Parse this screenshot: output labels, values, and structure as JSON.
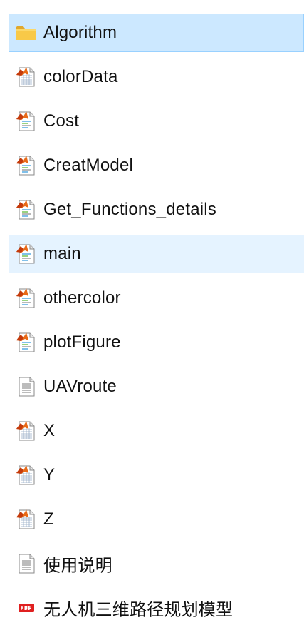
{
  "files": [
    {
      "name": "Algorithm",
      "icon": "folder-icon",
      "state": "selected"
    },
    {
      "name": "colorData",
      "icon": "matlab-data-file-icon",
      "state": ""
    },
    {
      "name": "Cost",
      "icon": "matlab-script-file-icon",
      "state": ""
    },
    {
      "name": "CreatModel",
      "icon": "matlab-script-file-icon",
      "state": ""
    },
    {
      "name": "Get_Functions_details",
      "icon": "matlab-script-file-icon",
      "state": ""
    },
    {
      "name": "main",
      "icon": "matlab-script-file-icon",
      "state": "hovered"
    },
    {
      "name": "othercolor",
      "icon": "matlab-script-file-icon",
      "state": ""
    },
    {
      "name": "plotFigure",
      "icon": "matlab-script-file-icon",
      "state": ""
    },
    {
      "name": "UAVroute",
      "icon": "text-file-icon",
      "state": ""
    },
    {
      "name": "X",
      "icon": "matlab-data-file-icon",
      "state": ""
    },
    {
      "name": "Y",
      "icon": "matlab-data-file-icon",
      "state": ""
    },
    {
      "name": "Z",
      "icon": "matlab-data-file-icon",
      "state": ""
    },
    {
      "name": "使用说明",
      "icon": "text-file-icon",
      "state": ""
    },
    {
      "name": "无人机三维路径规划模型",
      "icon": "pdf-file-icon",
      "state": ""
    }
  ],
  "colors": {
    "selected_bg": "#cce8ff",
    "selected_border": "#99d1ff",
    "hover_bg": "#e5f3ff",
    "folder": "#f8c948",
    "pdf": "#e02020",
    "matlab_orange": "#e86a18"
  }
}
